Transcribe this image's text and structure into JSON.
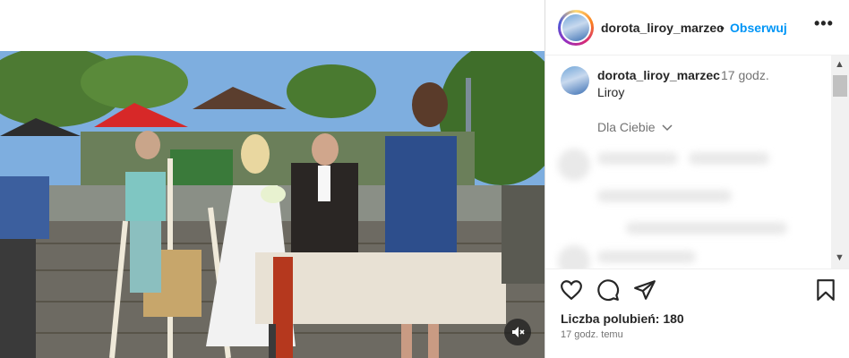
{
  "post": {
    "username": "dorota_liroy_marzec",
    "separator": "•",
    "follow_label": "Obserwuj",
    "more_label": "•••"
  },
  "caption": {
    "username": "dorota_liroy_marzec",
    "time": "17 godz.",
    "text": "Liroy",
    "translate_label": "Dla Ciebie"
  },
  "engagement": {
    "likes_label": "Liczba polubień: 180",
    "posted_label": "17 godz. temu"
  },
  "icons": {
    "like": "heart-icon",
    "comment": "comment-icon",
    "share": "send-icon",
    "save": "bookmark-icon",
    "mute": "speaker-muted-icon"
  },
  "colors": {
    "accent": "#0095f6",
    "text": "#262626",
    "secondary": "#737373"
  }
}
